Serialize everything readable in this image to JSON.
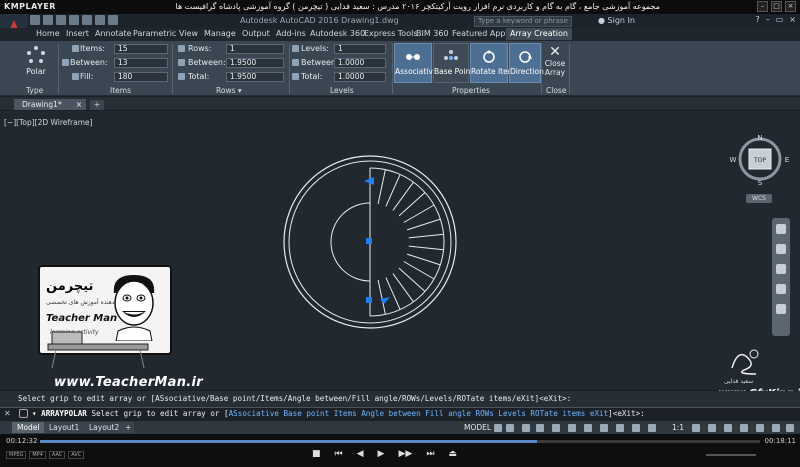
{
  "player": {
    "logo": "KMPLAYER",
    "title": "مجموعه آموزشی جامع ، گام به گام و کاربردی نرم افزار رویت آرکیتکچر ۲۰۱۶   مدرس : سعید فدایی ( تیچرمن ) گروه آموزشی پادشاه گرافیست ها",
    "time_current": "00:12:32",
    "time_total": "00:18:11",
    "progress": 0.69,
    "tags": [
      "MPEG",
      "MP4",
      "AAC",
      "AVC"
    ]
  },
  "app": {
    "title": "Autodesk AutoCAD 2016   Drawing1.dwg",
    "search_placeholder": "Type a keyword or phrase",
    "sign_in": "Sign In"
  },
  "ribbon_tabs": [
    "Home",
    "Insert",
    "Annotate",
    "Parametric",
    "View",
    "Manage",
    "Output",
    "Add-ins",
    "Autodesk 360",
    "Express Tools",
    "BIM 360",
    "Featured Apps",
    "Array Creation"
  ],
  "ribbon": {
    "type_panel": {
      "button": "Polar",
      "label": "Type"
    },
    "items_panel": {
      "label": "Items",
      "fields": [
        {
          "label": "Items:",
          "value": "15"
        },
        {
          "label": "Between:",
          "value": "13"
        },
        {
          "label": "Fill:",
          "value": "180"
        }
      ]
    },
    "rows_panel": {
      "label": "Rows ▾",
      "fields": [
        {
          "label": "Rows:",
          "value": "1"
        },
        {
          "label": "Between:",
          "value": "1.9500"
        },
        {
          "label": "Total:",
          "value": "1.9500"
        }
      ]
    },
    "levels_panel": {
      "label": "Levels",
      "fields": [
        {
          "label": "Levels:",
          "value": "1"
        },
        {
          "label": "Between:",
          "value": "1.0000"
        },
        {
          "label": "Total:",
          "value": "1.0000"
        }
      ]
    },
    "properties_panel": {
      "label": "Properties",
      "buttons": [
        "Associative",
        "Base Point",
        "Rotate Items",
        "Direction"
      ]
    },
    "close_panel": {
      "button_line1": "Close",
      "button_line2": "Array",
      "label": "Close"
    }
  },
  "file_tab": "Drawing1*",
  "viewport": {
    "label": "[−][Top][2D Wireframe]",
    "viewcube": {
      "n": "N",
      "s": "S",
      "e": "E",
      "w": "W",
      "face": "TOP",
      "wcs": "WCS"
    }
  },
  "overlay": {
    "brand": "تیچرمن",
    "brand_sub": "ارائه دهنده آموزش های تخصصی",
    "name": "Teacher Man",
    "tagline": "learning activity",
    "url": "www.TeacherMan.ir",
    "gfx_name": "سعید فدایی",
    "gfx_url": "www.GfxKing.ir"
  },
  "command": {
    "history": "Select grip to edit array or [ASsociative/Base point/Items/Angle between/Fill angle/ROWs/Levels/ROTate items/eXit]<eXit>:",
    "cmd_name": "▾ ARRAYPOLAR",
    "prompt_start": "Select grip to edit array or [",
    "keywords": [
      "ASsociative",
      "Base point",
      "Items",
      "Angle between",
      "Fill angle",
      "ROWs",
      "Levels",
      "ROTate items",
      "eXit"
    ],
    "prompt_end": "]<eXit>:"
  },
  "layout_tabs": [
    "Model",
    "Layout1",
    "Layout2"
  ],
  "status": {
    "model": "MODEL",
    "scale": "1:1"
  }
}
